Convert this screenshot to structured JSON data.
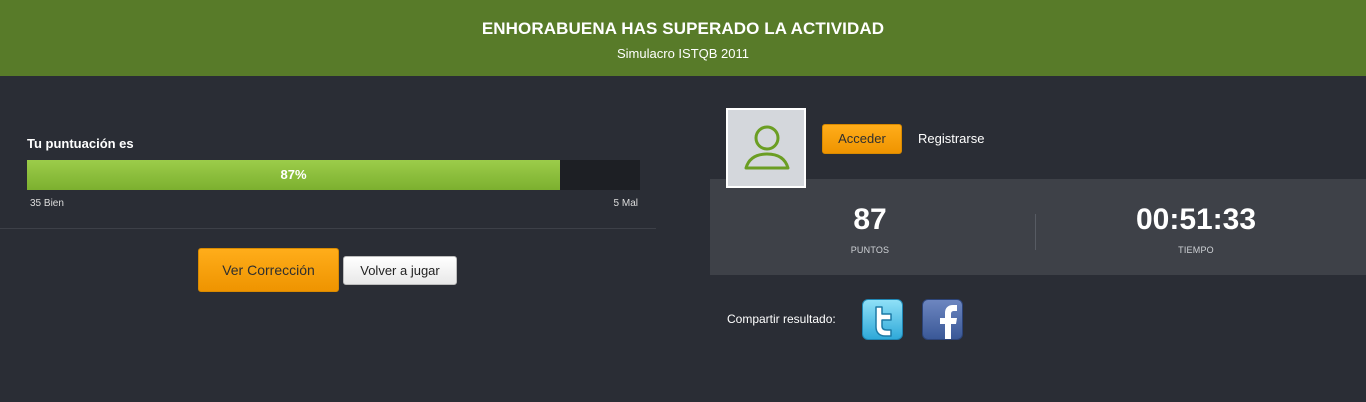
{
  "header": {
    "title": "ENHORABUENA HAS SUPERADO LA ACTIVIDAD",
    "subtitle": "Simulacro ISTQB 2011"
  },
  "score": {
    "label": "Tu puntuación es",
    "percent_text": "87%",
    "percent_value": 87,
    "good_text": "35 Bien",
    "bad_text": "5 Mal"
  },
  "buttons": {
    "ver_correccion": "Ver Corrección",
    "volver_a_jugar": "Volver a jugar",
    "acceder": "Acceder",
    "registrarse": "Registrarse"
  },
  "stats": {
    "points_value": "87",
    "points_label": "PUNTOS",
    "time_value": "00:51:33",
    "time_label": "TIEMPO"
  },
  "share": {
    "label": "Compartir resultado:",
    "icons": [
      "twitter-icon",
      "facebook-icon"
    ]
  },
  "colors": {
    "header_bg": "#587b29",
    "page_bg": "#2a2d35",
    "progress_fill": "#8ec23f",
    "accent_orange": "#f5a00a"
  }
}
